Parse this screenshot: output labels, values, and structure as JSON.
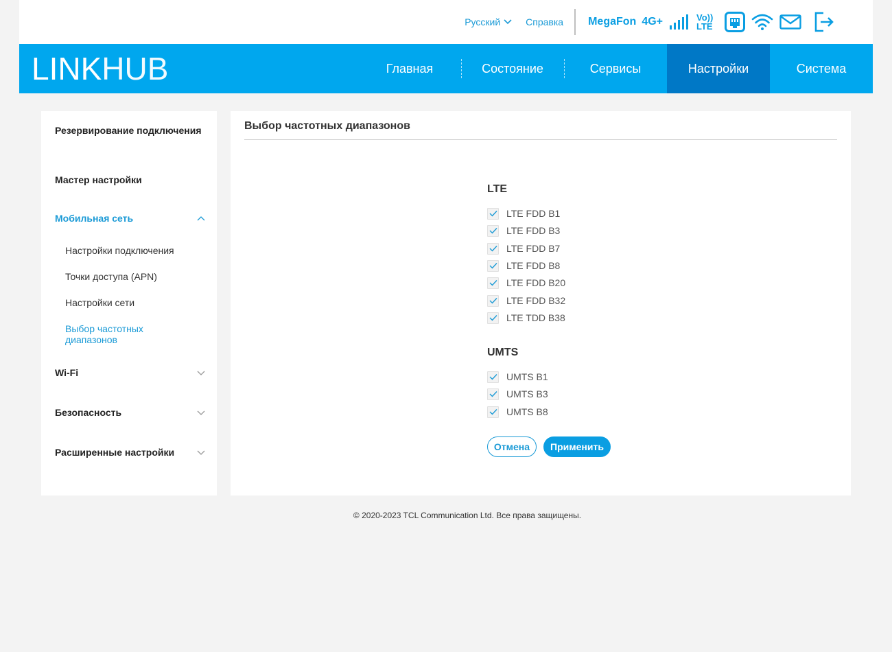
{
  "topbar": {
    "language": "Русский",
    "help": "Справка",
    "operator": "MegaFon",
    "network_type": "4G+",
    "volte_line1": "Vo))",
    "volte_line2": "LTE"
  },
  "header": {
    "logo_bold": "LINK",
    "logo_thin": "HUB",
    "nav": [
      "Главная",
      "Состояние",
      "Сервисы",
      "Настройки",
      "Система"
    ],
    "active_nav": "Настройки"
  },
  "sidebar": {
    "items": [
      "Резервирование подключения",
      "Мастер настройки",
      "Мобильная сеть",
      "Wi-Fi",
      "Безопасность",
      "Расширенные настройки"
    ],
    "mobile_sub": [
      "Настройки подключения",
      "Точки доступа (APN)",
      "Настройки сети",
      "Выбор частотных диапазонов"
    ]
  },
  "panel": {
    "title": "Выбор частотных диапазонов",
    "lte_title": "LTE",
    "lte_bands": [
      "LTE FDD B1",
      "LTE FDD B3",
      "LTE FDD B7",
      "LTE FDD B8",
      "LTE FDD B20",
      "LTE FDD B32",
      "LTE TDD B38"
    ],
    "umts_title": "UMTS",
    "umts_bands": [
      "UMTS B1",
      "UMTS B3",
      "UMTS B8"
    ],
    "cancel": "Отмена",
    "apply": "Применить"
  },
  "footer": "© 2020-2023 TCL Communication Ltd. Все права защищены.",
  "colors": {
    "accent": "#00a7ee",
    "nav_active": "#0078c6",
    "link": "#1a9ad6"
  }
}
